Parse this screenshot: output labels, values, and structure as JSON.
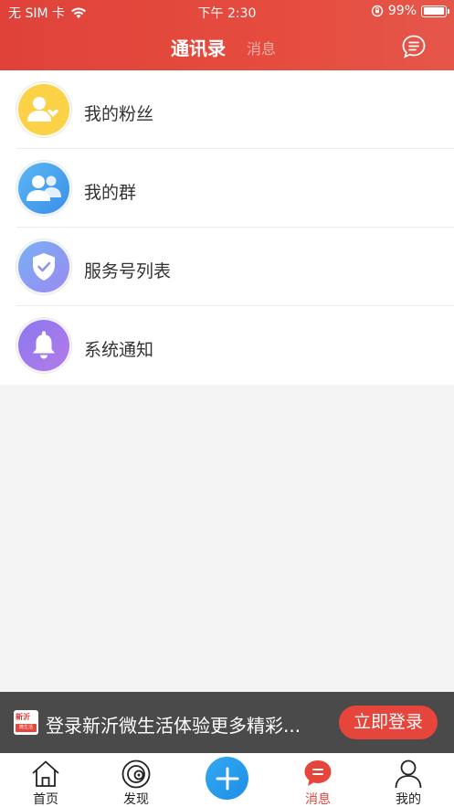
{
  "status_bar": {
    "carrier": "无 SIM 卡",
    "time": "下午 2:30",
    "battery": "99%",
    "battery_level": 0.99
  },
  "header": {
    "active_tab": "通讯录",
    "inactive_tab": "消息"
  },
  "list": [
    {
      "label": "我的粉丝",
      "icon": "fans-icon",
      "color": "#fbd148"
    },
    {
      "label": "我的群",
      "icon": "group-icon",
      "color": "#4aa3f0"
    },
    {
      "label": "服务号列表",
      "icon": "shield-icon",
      "color": "#8f8ff2"
    },
    {
      "label": "系统通知",
      "icon": "bell-icon",
      "color": "#a36de8"
    }
  ],
  "banner": {
    "logo_top": "新沂",
    "logo_bottom": "微生活",
    "text": "登录新沂微生活体验更多精彩...",
    "login_label": "立即登录"
  },
  "tabbar": {
    "home": "首页",
    "discover": "发现",
    "messages": "消息",
    "mine": "我的"
  },
  "colors": {
    "brand": "#e5453a",
    "accent_blue": "#2a9bee"
  }
}
